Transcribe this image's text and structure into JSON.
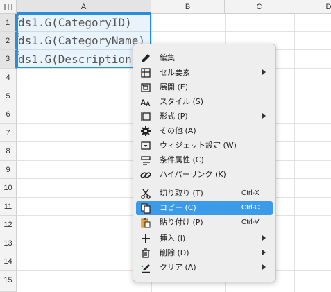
{
  "columns": [
    "A",
    "B",
    "C",
    "D"
  ],
  "rows": [
    "1",
    "2",
    "3",
    "4",
    "5",
    "6",
    "7",
    "8",
    "9",
    "10",
    "11",
    "12",
    "13",
    "14",
    "15"
  ],
  "cells": {
    "a1": "ds1.G(CategoryID)",
    "a2": "ds1.G(CategoryName)",
    "a3": "ds1.G(Description)"
  },
  "selection": {
    "range": "A1:A3",
    "accent": "#2a8cdc"
  },
  "context_menu": {
    "items": [
      {
        "icon": "pencil-icon",
        "label": "編集"
      },
      {
        "icon": "table-cell-icon",
        "label": "セル要素",
        "submenu": true
      },
      {
        "icon": "expand-icon",
        "label": "展開 (E)"
      },
      {
        "icon": "text-style-icon",
        "label": "スタイル (S)"
      },
      {
        "icon": "format-icon",
        "label": "形式 (P)",
        "submenu": true
      },
      {
        "icon": "gear-icon",
        "label": "その他 (A)"
      },
      {
        "icon": "widget-icon",
        "label": "ウィジェット設定 (W)"
      },
      {
        "icon": "condition-icon",
        "label": "条件属性 (C)"
      },
      {
        "icon": "link-icon",
        "label": "ハイパーリンク (K)"
      },
      {
        "icon": "scissors-icon",
        "label": "切り取り (T)",
        "shortcut": "Ctrl-X"
      },
      {
        "icon": "copy-icon",
        "label": "コピー (C)",
        "shortcut": "Ctrl-C",
        "active": true
      },
      {
        "icon": "paste-icon",
        "label": "貼り付け (P)",
        "shortcut": "Ctrl-V"
      },
      {
        "icon": "plus-icon",
        "label": "挿入 (I)",
        "submenu": true
      },
      {
        "icon": "trash-icon",
        "label": "削除 (D)",
        "submenu": true
      },
      {
        "icon": "eraser-icon",
        "label": "クリア (A)",
        "submenu": true
      }
    ],
    "active_color": "#3c9be8"
  }
}
